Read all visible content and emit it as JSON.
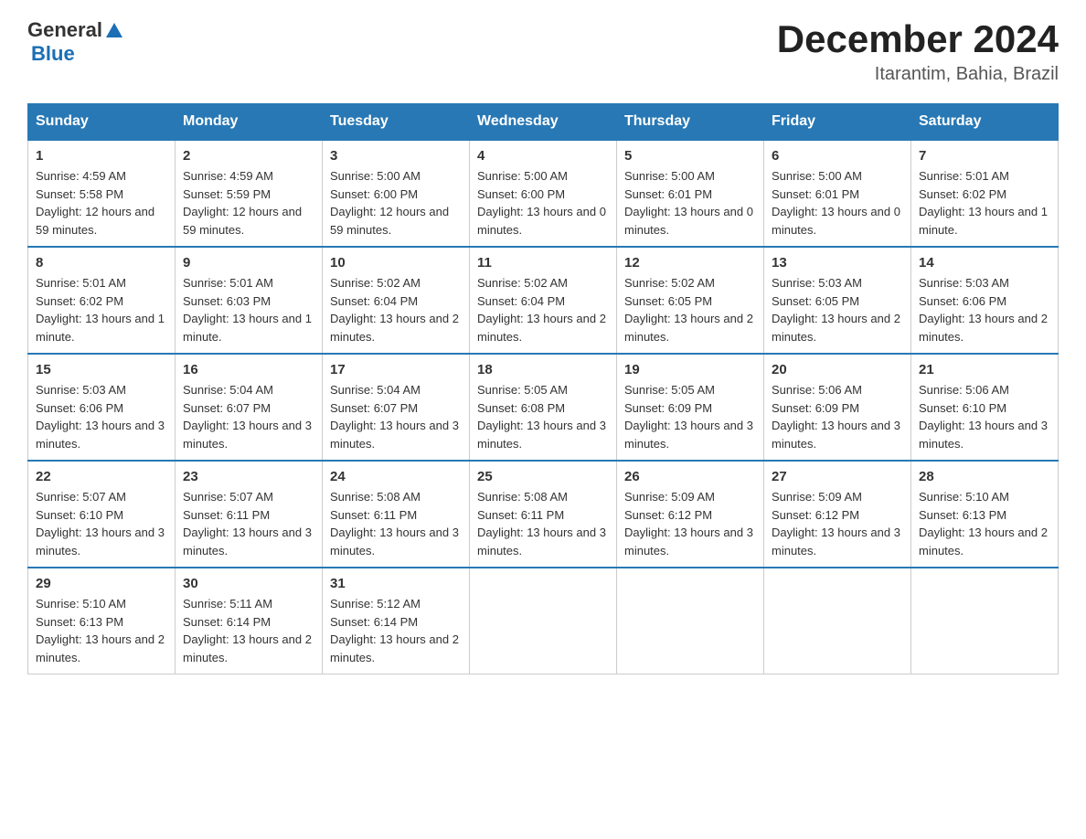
{
  "header": {
    "logo_general": "General",
    "logo_blue": "Blue",
    "month_title": "December 2024",
    "location": "Itarantim, Bahia, Brazil"
  },
  "weekdays": [
    "Sunday",
    "Monday",
    "Tuesday",
    "Wednesday",
    "Thursday",
    "Friday",
    "Saturday"
  ],
  "weeks": [
    [
      {
        "day": "1",
        "sunrise": "4:59 AM",
        "sunset": "5:58 PM",
        "daylight": "12 hours and 59 minutes."
      },
      {
        "day": "2",
        "sunrise": "4:59 AM",
        "sunset": "5:59 PM",
        "daylight": "12 hours and 59 minutes."
      },
      {
        "day": "3",
        "sunrise": "5:00 AM",
        "sunset": "6:00 PM",
        "daylight": "12 hours and 59 minutes."
      },
      {
        "day": "4",
        "sunrise": "5:00 AM",
        "sunset": "6:00 PM",
        "daylight": "13 hours and 0 minutes."
      },
      {
        "day": "5",
        "sunrise": "5:00 AM",
        "sunset": "6:01 PM",
        "daylight": "13 hours and 0 minutes."
      },
      {
        "day": "6",
        "sunrise": "5:00 AM",
        "sunset": "6:01 PM",
        "daylight": "13 hours and 0 minutes."
      },
      {
        "day": "7",
        "sunrise": "5:01 AM",
        "sunset": "6:02 PM",
        "daylight": "13 hours and 1 minute."
      }
    ],
    [
      {
        "day": "8",
        "sunrise": "5:01 AM",
        "sunset": "6:02 PM",
        "daylight": "13 hours and 1 minute."
      },
      {
        "day": "9",
        "sunrise": "5:01 AM",
        "sunset": "6:03 PM",
        "daylight": "13 hours and 1 minute."
      },
      {
        "day": "10",
        "sunrise": "5:02 AM",
        "sunset": "6:04 PM",
        "daylight": "13 hours and 2 minutes."
      },
      {
        "day": "11",
        "sunrise": "5:02 AM",
        "sunset": "6:04 PM",
        "daylight": "13 hours and 2 minutes."
      },
      {
        "day": "12",
        "sunrise": "5:02 AM",
        "sunset": "6:05 PM",
        "daylight": "13 hours and 2 minutes."
      },
      {
        "day": "13",
        "sunrise": "5:03 AM",
        "sunset": "6:05 PM",
        "daylight": "13 hours and 2 minutes."
      },
      {
        "day": "14",
        "sunrise": "5:03 AM",
        "sunset": "6:06 PM",
        "daylight": "13 hours and 2 minutes."
      }
    ],
    [
      {
        "day": "15",
        "sunrise": "5:03 AM",
        "sunset": "6:06 PM",
        "daylight": "13 hours and 3 minutes."
      },
      {
        "day": "16",
        "sunrise": "5:04 AM",
        "sunset": "6:07 PM",
        "daylight": "13 hours and 3 minutes."
      },
      {
        "day": "17",
        "sunrise": "5:04 AM",
        "sunset": "6:07 PM",
        "daylight": "13 hours and 3 minutes."
      },
      {
        "day": "18",
        "sunrise": "5:05 AM",
        "sunset": "6:08 PM",
        "daylight": "13 hours and 3 minutes."
      },
      {
        "day": "19",
        "sunrise": "5:05 AM",
        "sunset": "6:09 PM",
        "daylight": "13 hours and 3 minutes."
      },
      {
        "day": "20",
        "sunrise": "5:06 AM",
        "sunset": "6:09 PM",
        "daylight": "13 hours and 3 minutes."
      },
      {
        "day": "21",
        "sunrise": "5:06 AM",
        "sunset": "6:10 PM",
        "daylight": "13 hours and 3 minutes."
      }
    ],
    [
      {
        "day": "22",
        "sunrise": "5:07 AM",
        "sunset": "6:10 PM",
        "daylight": "13 hours and 3 minutes."
      },
      {
        "day": "23",
        "sunrise": "5:07 AM",
        "sunset": "6:11 PM",
        "daylight": "13 hours and 3 minutes."
      },
      {
        "day": "24",
        "sunrise": "5:08 AM",
        "sunset": "6:11 PM",
        "daylight": "13 hours and 3 minutes."
      },
      {
        "day": "25",
        "sunrise": "5:08 AM",
        "sunset": "6:11 PM",
        "daylight": "13 hours and 3 minutes."
      },
      {
        "day": "26",
        "sunrise": "5:09 AM",
        "sunset": "6:12 PM",
        "daylight": "13 hours and 3 minutes."
      },
      {
        "day": "27",
        "sunrise": "5:09 AM",
        "sunset": "6:12 PM",
        "daylight": "13 hours and 3 minutes."
      },
      {
        "day": "28",
        "sunrise": "5:10 AM",
        "sunset": "6:13 PM",
        "daylight": "13 hours and 2 minutes."
      }
    ],
    [
      {
        "day": "29",
        "sunrise": "5:10 AM",
        "sunset": "6:13 PM",
        "daylight": "13 hours and 2 minutes."
      },
      {
        "day": "30",
        "sunrise": "5:11 AM",
        "sunset": "6:14 PM",
        "daylight": "13 hours and 2 minutes."
      },
      {
        "day": "31",
        "sunrise": "5:12 AM",
        "sunset": "6:14 PM",
        "daylight": "13 hours and 2 minutes."
      },
      null,
      null,
      null,
      null
    ]
  ]
}
